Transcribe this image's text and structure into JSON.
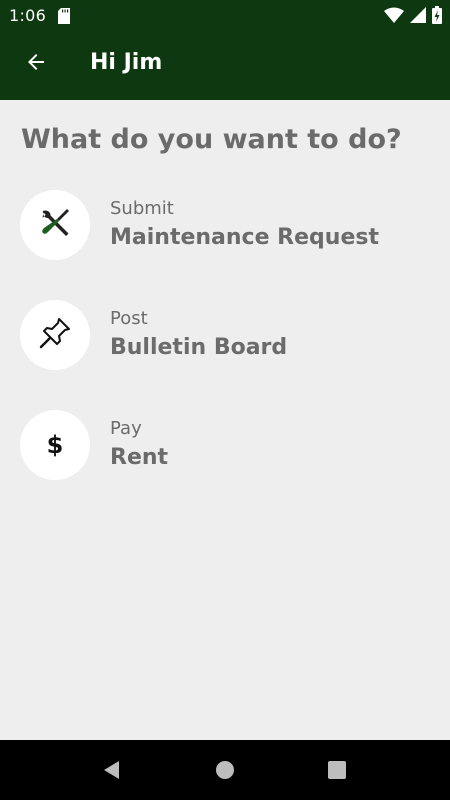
{
  "status_bar": {
    "time": "1:06"
  },
  "app_bar": {
    "title": "Hi Jim"
  },
  "main": {
    "prompt": "What do you want to do?",
    "actions": [
      {
        "sub": "Submit",
        "main": "Maintenance Request",
        "icon": "tools-icon"
      },
      {
        "sub": "Post",
        "main": "Bulletin Board",
        "icon": "pushpin-icon"
      },
      {
        "sub": "Pay",
        "main": "Rent",
        "icon": "dollar-icon"
      }
    ],
    "dollar_glyph": "$"
  },
  "colors": {
    "primary": "#0d3810",
    "background": "#eeeeee",
    "text": "#6b6b6b",
    "icon_green": "#1b5e20"
  }
}
